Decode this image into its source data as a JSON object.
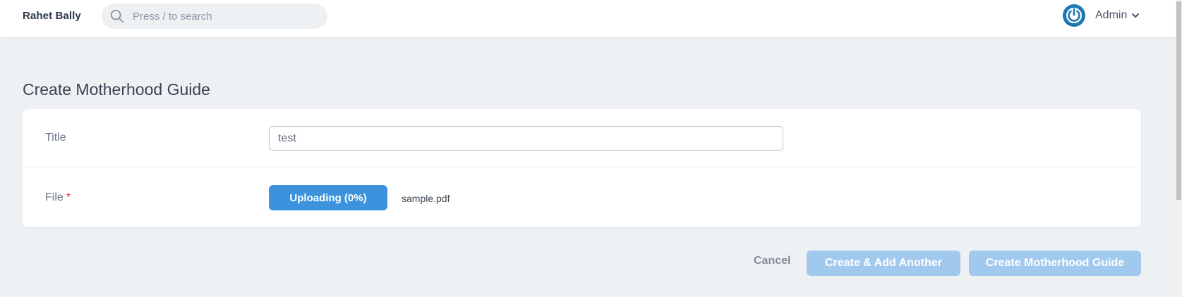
{
  "header": {
    "brand": "Rahet Bally",
    "search_placeholder": "Press / to search",
    "user_name": "Admin"
  },
  "page": {
    "title": "Create Motherhood Guide"
  },
  "form": {
    "title_label": "Title",
    "title_value": "test",
    "file_label": "File",
    "file_required_mark": "*",
    "upload_button_label": "Uploading (0%)",
    "upload_progress_percent": 0,
    "file_name": "sample.pdf"
  },
  "actions": {
    "cancel_label": "Cancel",
    "create_add_another_label": "Create & Add Another",
    "create_label": "Create Motherhood Guide"
  },
  "colors": {
    "accent": "#3c92dd",
    "accent_disabled": "#a1c9ee",
    "background": "#eef1f4",
    "required": "#e3342f",
    "avatar_blue": "#1f77b4"
  },
  "icons": {
    "search": "search-icon",
    "avatar": "power-icon",
    "dropdown": "chevron-down-icon"
  }
}
